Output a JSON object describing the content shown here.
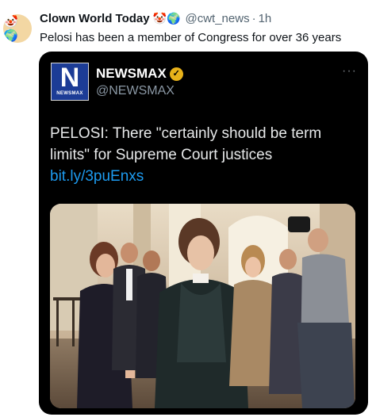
{
  "tweet": {
    "author_name": "Clown World Today",
    "author_emojis": "🤡🌍",
    "handle": "@cwt_news",
    "separator": "·",
    "time": "1h",
    "text": "Pelosi has been a member of Congress for over 36 years"
  },
  "quoted": {
    "logo_letter": "N",
    "logo_text": "NEWSMAX",
    "name": "NEWSMAX",
    "handle": "@NEWSMAX",
    "more_glyph": "···",
    "text": "PELOSI: There \"certainly should be term limits\" for Supreme Court justices ",
    "link": "bit.ly/3puEnxs"
  },
  "colors": {
    "link": "#1d9bf0",
    "card_bg": "#000000",
    "newsmax_blue": "#1c3c96",
    "verified_gold": "#e8b21a"
  }
}
